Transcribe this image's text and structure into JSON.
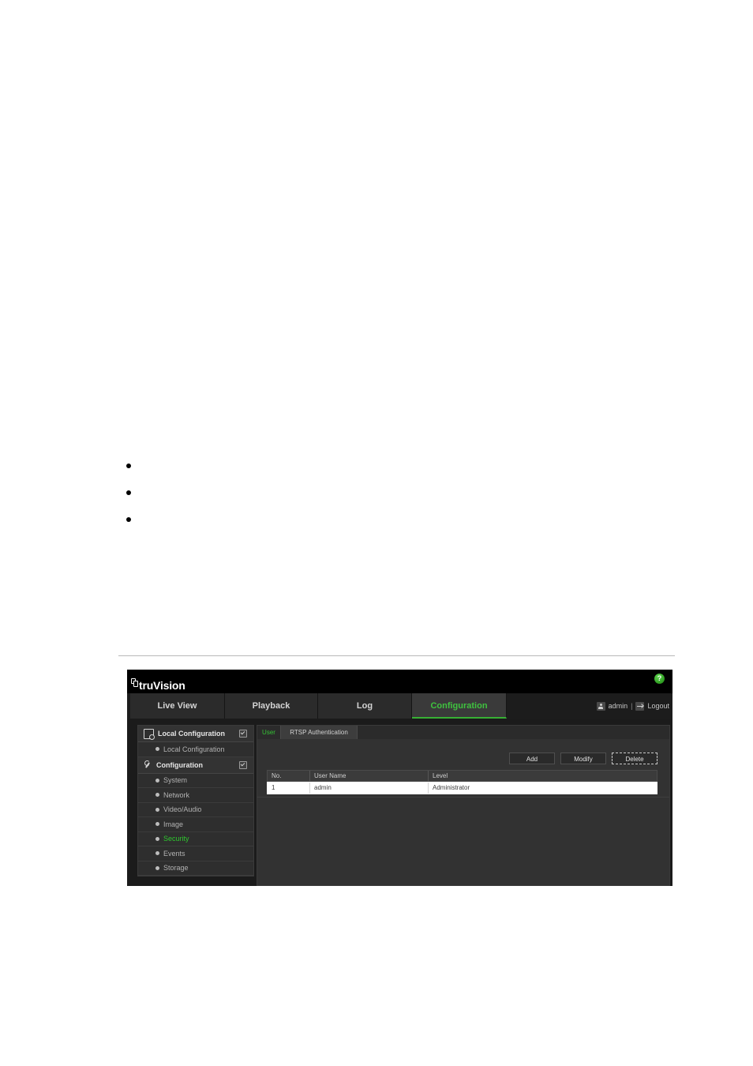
{
  "document": {
    "bullets": [
      "",
      "",
      ""
    ],
    "divider": true
  },
  "ui": {
    "brand": {
      "name": "truVision",
      "logo_icon": "truvision-logo-icon"
    },
    "help": {
      "label": "?",
      "icon": "help-icon",
      "color": "#2f9e22"
    },
    "account": {
      "user_icon": "user-icon",
      "user_name": "admin",
      "separator": "|",
      "logout_icon": "logout-icon",
      "logout_label": "Logout"
    },
    "main_tabs": [
      {
        "label": "Live View",
        "active": false
      },
      {
        "label": "Playback",
        "active": false
      },
      {
        "label": "Log",
        "active": false
      },
      {
        "label": "Configuration",
        "active": true
      }
    ],
    "accent_color": "#37b034",
    "sidebar": {
      "groups": [
        {
          "label": "Local Configuration",
          "icon": "camera-icon",
          "expander_icon": "collapse-checkbox-icon",
          "items": [
            {
              "label": "Local Configuration",
              "active": false
            }
          ]
        },
        {
          "label": "Configuration",
          "icon": "wrench-icon",
          "expander_icon": "collapse-checkbox-icon",
          "items": [
            {
              "label": "System",
              "active": false
            },
            {
              "label": "Network",
              "active": false
            },
            {
              "label": "Video/Audio",
              "active": false
            },
            {
              "label": "Image",
              "active": false
            },
            {
              "label": "Security",
              "active": true
            },
            {
              "label": "Events",
              "active": false
            },
            {
              "label": "Storage",
              "active": false
            }
          ]
        }
      ]
    },
    "content": {
      "sub_tabs": [
        {
          "label": "User",
          "active": true
        },
        {
          "label": "RTSP Authentication",
          "active": false
        }
      ],
      "buttons": [
        {
          "label": "Add",
          "focused": false
        },
        {
          "label": "Modify",
          "focused": false
        },
        {
          "label": "Delete",
          "focused": true
        }
      ],
      "table": {
        "columns": [
          "No.",
          "User Name",
          "Level"
        ],
        "rows": [
          {
            "no": "1",
            "user_name": "admin",
            "level": "Administrator"
          }
        ]
      }
    }
  }
}
